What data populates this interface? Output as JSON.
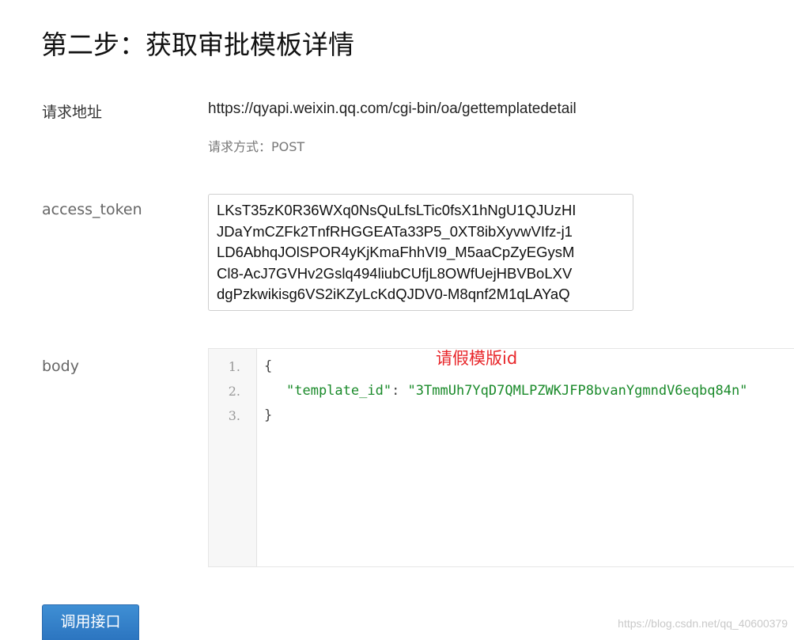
{
  "heading": "第二步：获取审批模板详情",
  "request": {
    "address_label": "请求地址",
    "url": "https://qyapi.weixin.qq.com/cgi-bin/oa/gettemplatedetail",
    "method_text": "请求方式：POST"
  },
  "access_token": {
    "label": "access_token",
    "lines": [
      "LKsT35zK0R36WXq0NsQuLfsLTic0fsX1hNgU1QJUzHI",
      "JDaYmCZFk2TnfRHGGEATa33P5_0XT8ibXyvwVIfz-j1",
      "LD6AbhqJOlSPOR4yKjKmaFhhVI9_M5aaCpZyEGysM",
      "Cl8-AcJ7GVHv2Gslq494liubCUfjL8OWfUejHBVBoLXV",
      "dgPzkwikisg6VS2iKZyLcKdQJDV0-M8qnf2M1qLAYaQ"
    ]
  },
  "body": {
    "label": "body",
    "line_numbers": [
      "1.",
      "2.",
      "3."
    ],
    "open_brace": "{",
    "key": "\"template_id\"",
    "colon": ": ",
    "value": "\"3TmmUh7YqD7QMLPZWKJFP8bvanYgmndV6eqbq84n\"",
    "close_brace": "}"
  },
  "annotation": "请假模版id",
  "call_button": "调用接口",
  "watermark": "https://blog.csdn.net/qq_40600379",
  "colors": {
    "button": "#2f7bc6",
    "annotation": "#e8262a",
    "string": "#1a8a2a"
  }
}
